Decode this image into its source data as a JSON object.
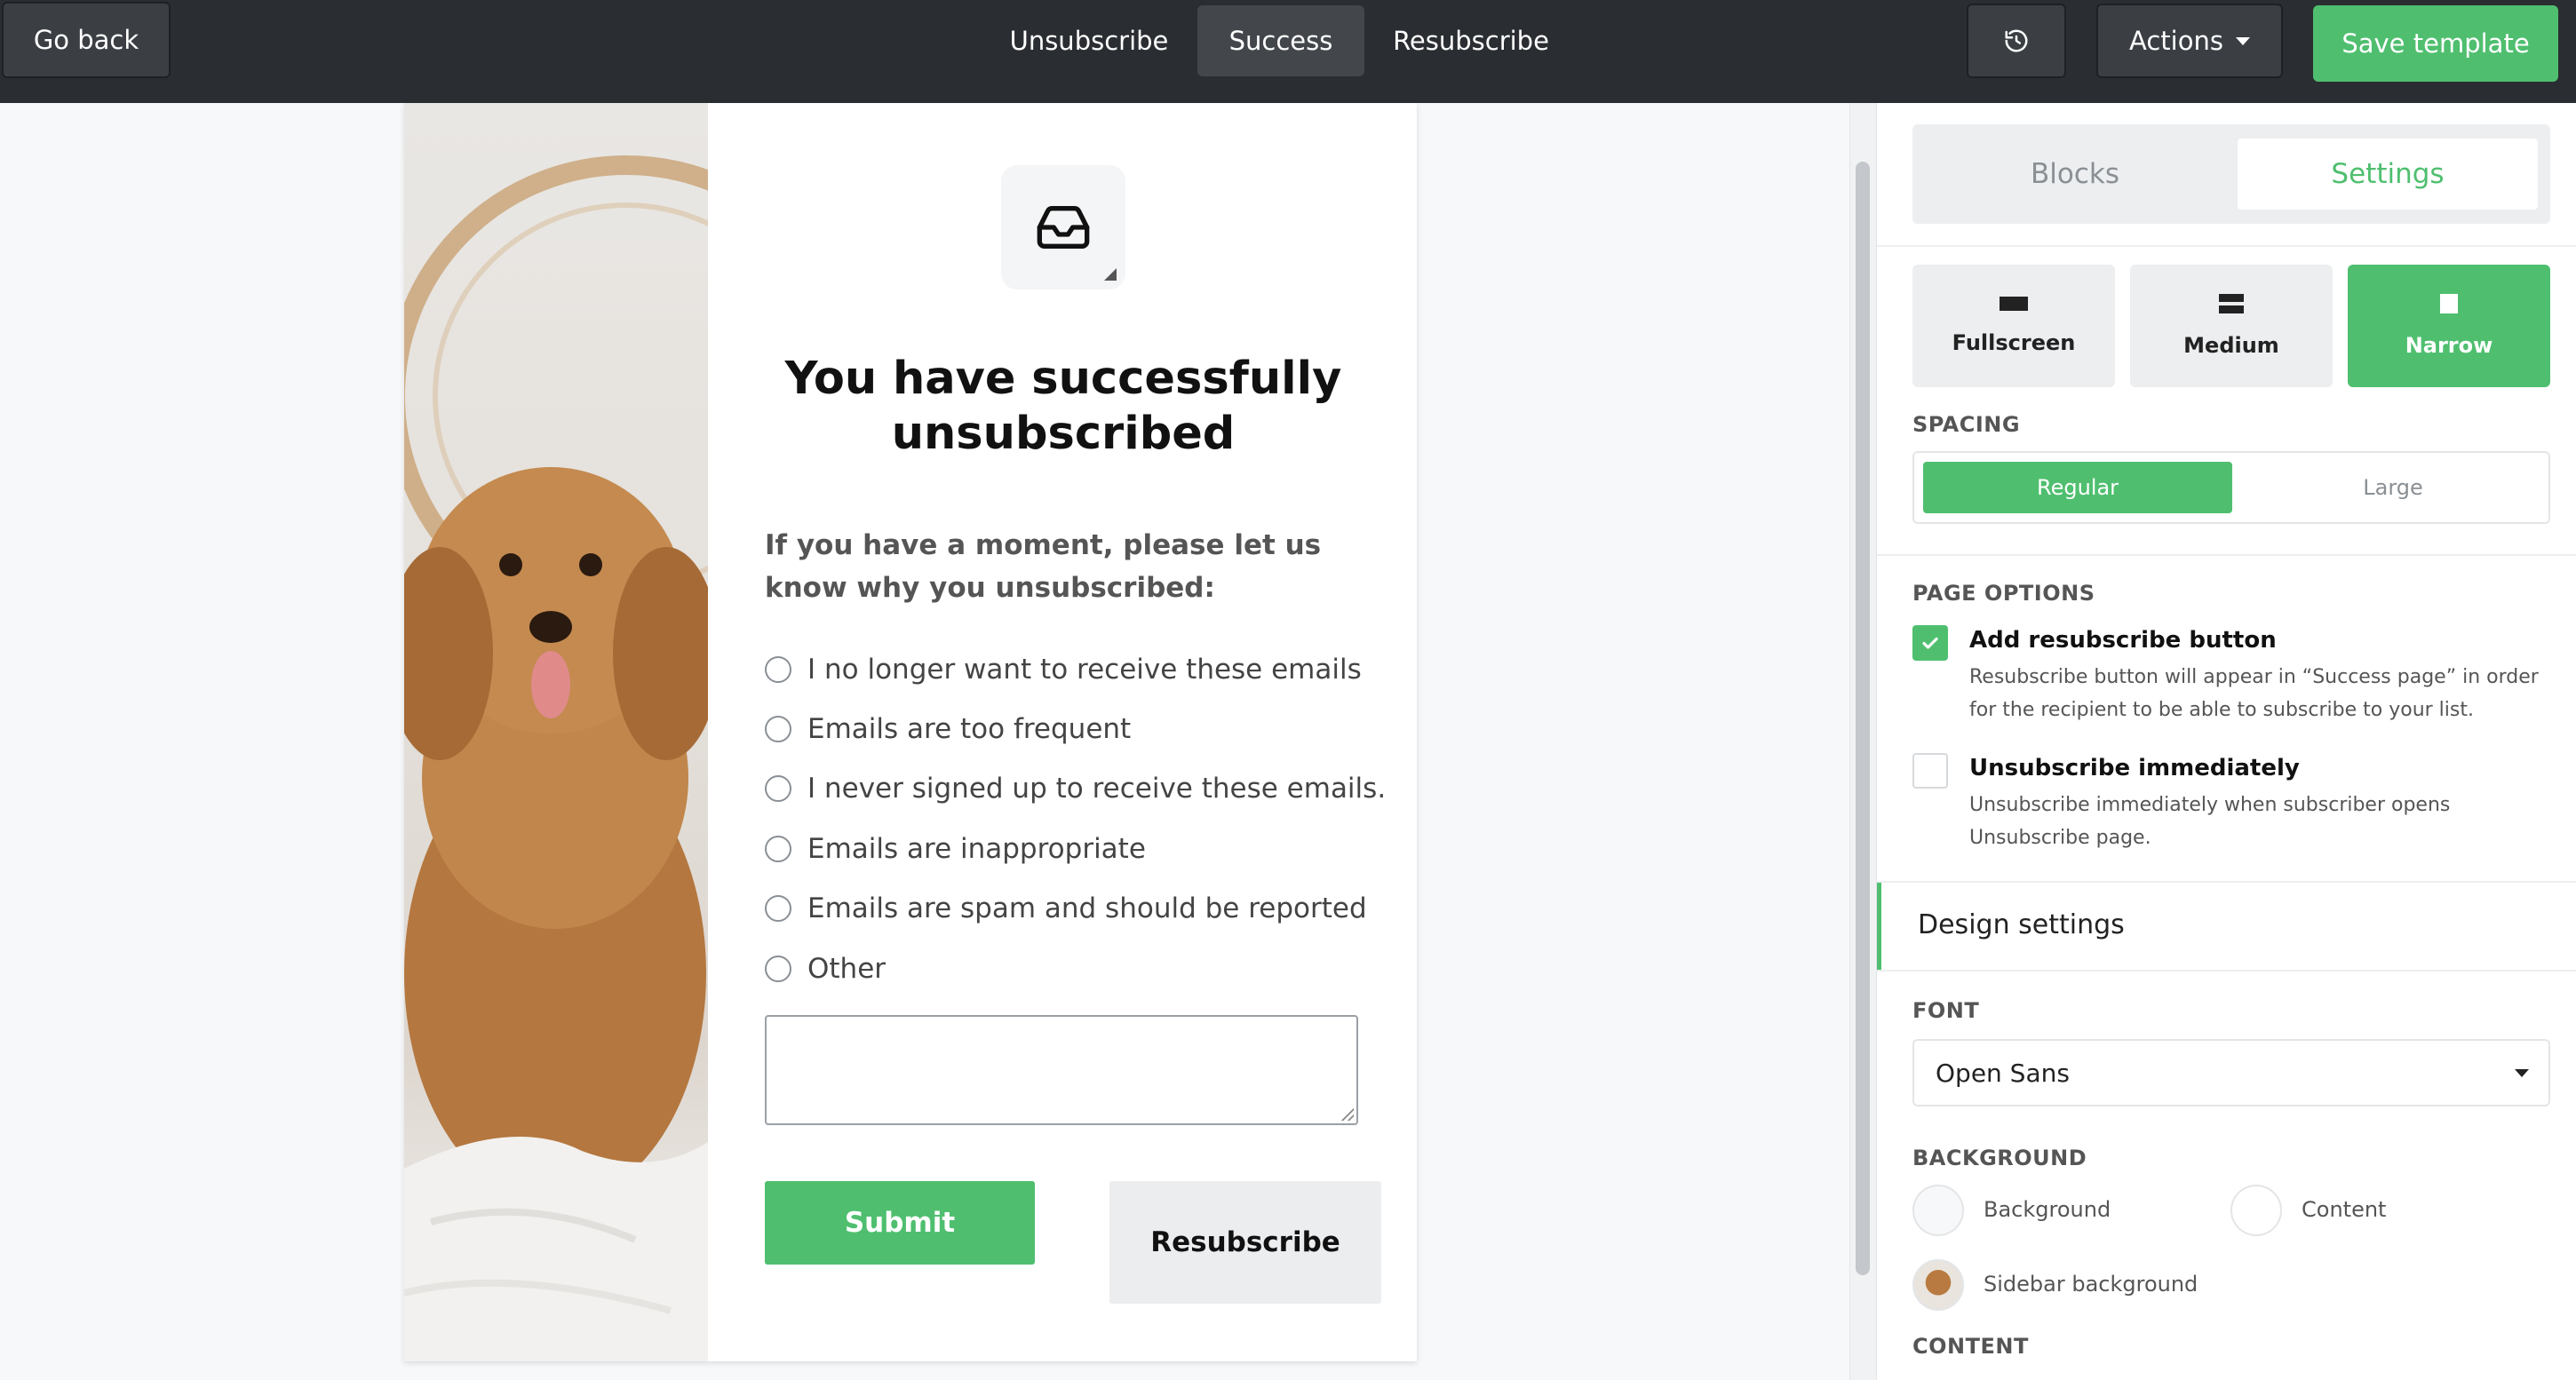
{
  "topbar": {
    "go_back": "Go back",
    "tabs": [
      "Unsubscribe",
      "Success",
      "Resubscribe"
    ],
    "active_tab": "Success",
    "history_icon": "history-icon",
    "actions": "Actions",
    "save": "Save template",
    "accent": "#4fbf6f"
  },
  "preview": {
    "heading": "You have successfully unsubscribed",
    "question": "If you have a moment, please let us know why you unsubscribed:",
    "options": [
      "I no longer want to receive these emails",
      "Emails are too frequent",
      "I never signed up to receive these emails.",
      "Emails are inappropriate",
      "Emails are spam and should be reported",
      "Other"
    ],
    "submit": "Submit",
    "resubscribe": "Resubscribe",
    "inbox_icon": "inbox-icon",
    "sidebar_image": "dog-photo"
  },
  "panel": {
    "tabs": [
      "Blocks",
      "Settings"
    ],
    "active_tab": "Settings",
    "layouts": [
      "Fullscreen",
      "Medium",
      "Narrow"
    ],
    "active_layout": "Narrow",
    "spacing_label": "SPACING",
    "spacing": [
      "Regular",
      "Large"
    ],
    "active_spacing": "Regular",
    "page_options_label": "PAGE OPTIONS",
    "options": [
      {
        "title": "Add resubscribe button",
        "desc": "Resubscribe button will appear in “Success page” in order for the recipient to be able to subscribe to your list.",
        "checked": true
      },
      {
        "title": "Unsubscribe immediately",
        "desc": "Unsubscribe immediately when subscriber opens Unsubscribe page.",
        "checked": false
      }
    ],
    "design_settings": "Design settings",
    "font_label": "FONT",
    "font_value": "Open Sans",
    "background_label": "BACKGROUND",
    "background_swatches": [
      "Background",
      "Content",
      "Sidebar background"
    ],
    "content_label": "CONTENT"
  }
}
